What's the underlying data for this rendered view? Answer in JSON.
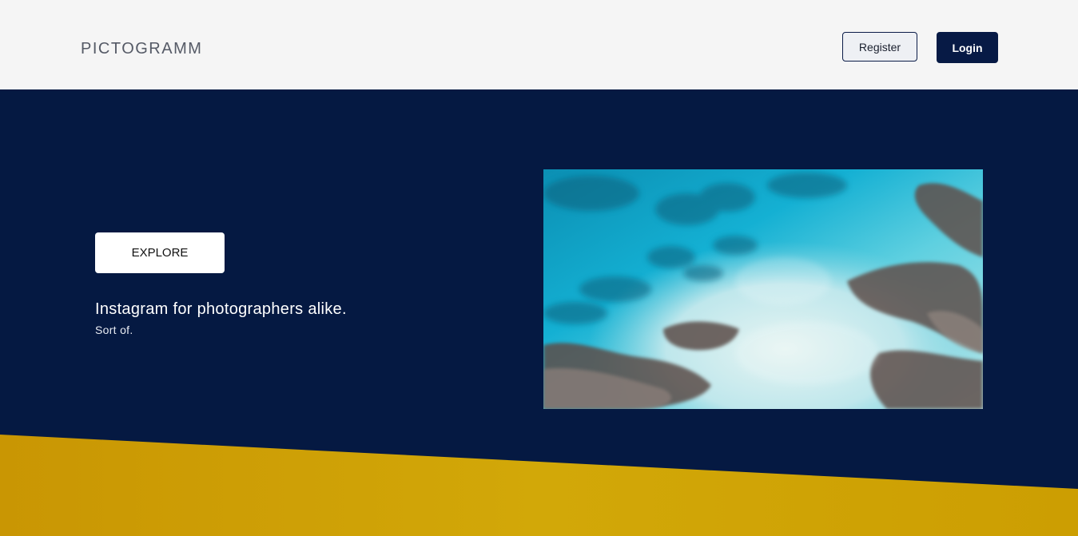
{
  "header": {
    "logo": "PICTOGRAMM",
    "register_label": "Register",
    "login_label": "Login"
  },
  "hero": {
    "explore_label": "EXPLORE",
    "tagline": "Instagram for photographers alike.",
    "subline": "Sort of."
  },
  "colors": {
    "header_bg": "#f5f5f5",
    "navy": "#051942",
    "login_bg": "#071a45",
    "yellow": "#cfa003",
    "white": "#ffffff"
  },
  "image": {
    "subject": "aerial view of turquoise sea and coral reef"
  }
}
